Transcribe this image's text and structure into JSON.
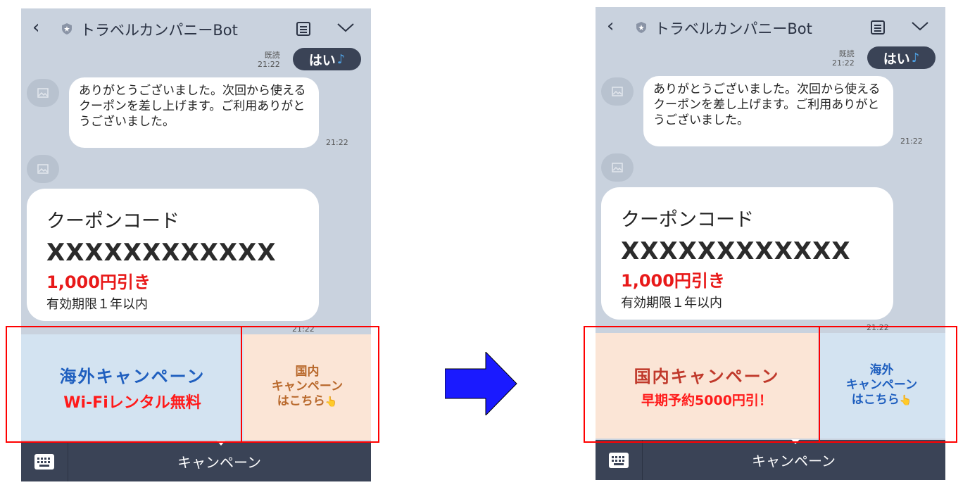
{
  "screens": [
    {
      "header": {
        "title": "トラベルカンパニーBot"
      },
      "sent": {
        "text": "はい",
        "read_label": "既読",
        "time": "21:22"
      },
      "received": {
        "text": "ありがとうございました。次回から使えるクーポンを差し上げます。ご利用ありがとうございました。",
        "time": "21:22"
      },
      "coupon": {
        "label": "クーポンコード",
        "code": "XXXXXXXXXXXX",
        "discount": "1,000円引き",
        "validity": "有効期限１年以内",
        "time": "21:22"
      },
      "richmenu": {
        "large": {
          "line1": "海外キャンペーン",
          "line2": "Wi-Fiレンタル無料"
        },
        "small": {
          "line1": "国内",
          "line2": "キャンペーン",
          "line3": "はこちら"
        }
      },
      "menu_label": "キャンペーン"
    },
    {
      "header": {
        "title": "トラベルカンパニーBot"
      },
      "sent": {
        "text": "はい",
        "read_label": "既読",
        "time": "21:22"
      },
      "received": {
        "text": "ありがとうございました。次回から使えるクーポンを差し上げます。ご利用ありがとうございました。",
        "time": "21:22"
      },
      "coupon": {
        "label": "クーポンコード",
        "code": "XXXXXXXXXXXX",
        "discount": "1,000円引き",
        "validity": "有効期限１年以内",
        "time": "21:22"
      },
      "richmenu": {
        "large": {
          "line1": "国内キャンペーン",
          "line2": "早期予約5000円引！"
        },
        "small": {
          "line1": "海外",
          "line2": "キャンペーン",
          "line3": "はこちら"
        }
      },
      "menu_label": "キャンペーン"
    }
  ],
  "colors": {
    "highlight": "#ff0000",
    "arrow": "#1a1aff",
    "chat_bg": "#c9d2de",
    "menu_bar": "#3a4356"
  }
}
